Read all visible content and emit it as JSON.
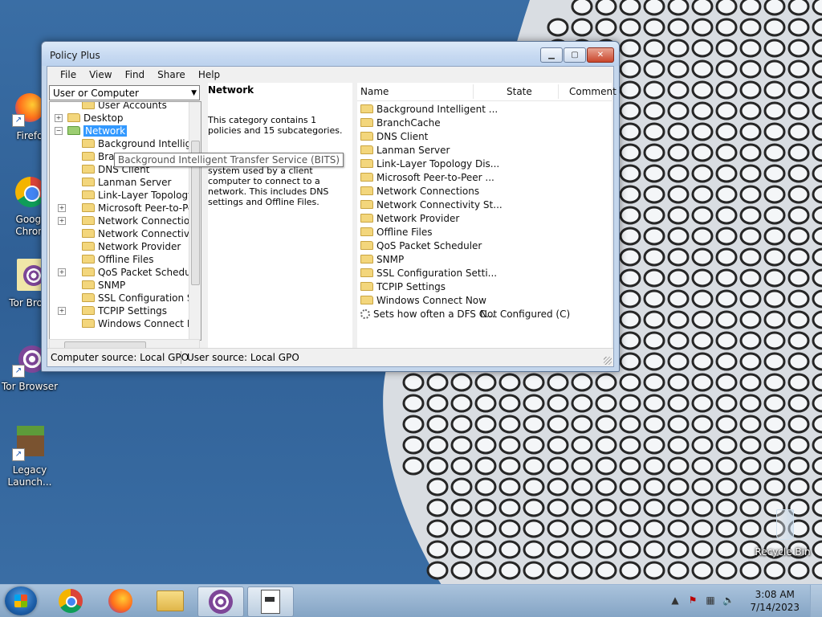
{
  "window": {
    "title": "Policy Plus",
    "minimize_glyph": "▁",
    "maximize_glyph": "▢",
    "close_glyph": "✕"
  },
  "menu": [
    "File",
    "View",
    "Find",
    "Share",
    "Help"
  ],
  "scope_select": {
    "value": "User or Computer"
  },
  "tree": {
    "items": [
      {
        "label": "User Accounts",
        "indent": 2,
        "expander": ""
      },
      {
        "label": "Desktop",
        "indent": 1,
        "expander": "+"
      },
      {
        "label": "Network",
        "indent": 1,
        "expander": "−",
        "selected": true,
        "open": true
      },
      {
        "label": "Background Intelligent T",
        "indent": 2,
        "expander": ""
      },
      {
        "label": "Branc",
        "indent": 2,
        "expander": ""
      },
      {
        "label": "DNS Client",
        "indent": 2,
        "expander": ""
      },
      {
        "label": "Lanman Server",
        "indent": 2,
        "expander": ""
      },
      {
        "label": "Link-Layer Topology Dis",
        "indent": 2,
        "expander": ""
      },
      {
        "label": "Microsoft Peer-to-Peer N",
        "indent": 2,
        "expander": "+"
      },
      {
        "label": "Network Connections",
        "indent": 2,
        "expander": "+"
      },
      {
        "label": "Network Connectivity S",
        "indent": 2,
        "expander": ""
      },
      {
        "label": "Network Provider",
        "indent": 2,
        "expander": ""
      },
      {
        "label": "Offline Files",
        "indent": 2,
        "expander": ""
      },
      {
        "label": "QoS Packet Scheduler",
        "indent": 2,
        "expander": "+"
      },
      {
        "label": "SNMP",
        "indent": 2,
        "expander": ""
      },
      {
        "label": "SSL Configuration Settin",
        "indent": 2,
        "expander": ""
      },
      {
        "label": "TCPIP Settings",
        "indent": 2,
        "expander": "+"
      },
      {
        "label": "Windows Connect Now",
        "indent": 2,
        "expander": ""
      }
    ]
  },
  "tooltip": "Background Intelligent Transfer Service (BITS)",
  "description": {
    "heading": "Network",
    "summary": "This category contains 1 policies and 15 subcategories.",
    "body": "components of the operating system used by a client computer to connect to a network. This includes DNS settings and Offline Files."
  },
  "list": {
    "columns": [
      "Name",
      "State",
      "Comment"
    ],
    "rows": [
      {
        "name": "Background Intelligent ...",
        "state": "",
        "kind": "folder"
      },
      {
        "name": "BranchCache",
        "state": "",
        "kind": "folder"
      },
      {
        "name": "DNS Client",
        "state": "",
        "kind": "folder"
      },
      {
        "name": "Lanman Server",
        "state": "",
        "kind": "folder"
      },
      {
        "name": "Link-Layer Topology Dis...",
        "state": "",
        "kind": "folder"
      },
      {
        "name": "Microsoft Peer-to-Peer ...",
        "state": "",
        "kind": "folder"
      },
      {
        "name": "Network Connections",
        "state": "",
        "kind": "folder"
      },
      {
        "name": "Network Connectivity St...",
        "state": "",
        "kind": "folder"
      },
      {
        "name": "Network Provider",
        "state": "",
        "kind": "folder"
      },
      {
        "name": "Offline Files",
        "state": "",
        "kind": "folder"
      },
      {
        "name": "QoS Packet Scheduler",
        "state": "",
        "kind": "folder"
      },
      {
        "name": "SNMP",
        "state": "",
        "kind": "folder"
      },
      {
        "name": "SSL Configuration Setti...",
        "state": "",
        "kind": "folder"
      },
      {
        "name": "TCPIP Settings",
        "state": "",
        "kind": "folder"
      },
      {
        "name": "Windows Connect Now",
        "state": "",
        "kind": "folder"
      },
      {
        "name": "Sets how often a DFS C...",
        "state": "Not Configured (C)",
        "kind": "policy"
      }
    ]
  },
  "status": {
    "computer_source": "Computer source:  Local GPO",
    "user_source": "User source:  Local GPO"
  },
  "desktop_icons": [
    {
      "label": "Firefo",
      "icon": "firefox-icon"
    },
    {
      "label": "Googl Chron",
      "icon": "chrome-icon"
    },
    {
      "label": "Tor Brow",
      "icon": "tor-browser-icon"
    },
    {
      "label": "Tor Browser",
      "icon": "tor-browser-icon"
    },
    {
      "label": "Legacy Launch...",
      "icon": "minecraft-icon"
    },
    {
      "label": "Recycle Bin",
      "icon": "recycle-bin-icon"
    }
  ],
  "taskbar": {
    "pinned": [
      "chrome-icon",
      "firefox-icon",
      "file-explorer-icon",
      "tor-browser-icon",
      "policy-plus-icon"
    ],
    "time": "3:08 AM",
    "date": "7/14/2023"
  },
  "colors": {
    "selection": "#3399ff",
    "desktop": "#3a6ea5",
    "close_button": "#c9462c"
  }
}
